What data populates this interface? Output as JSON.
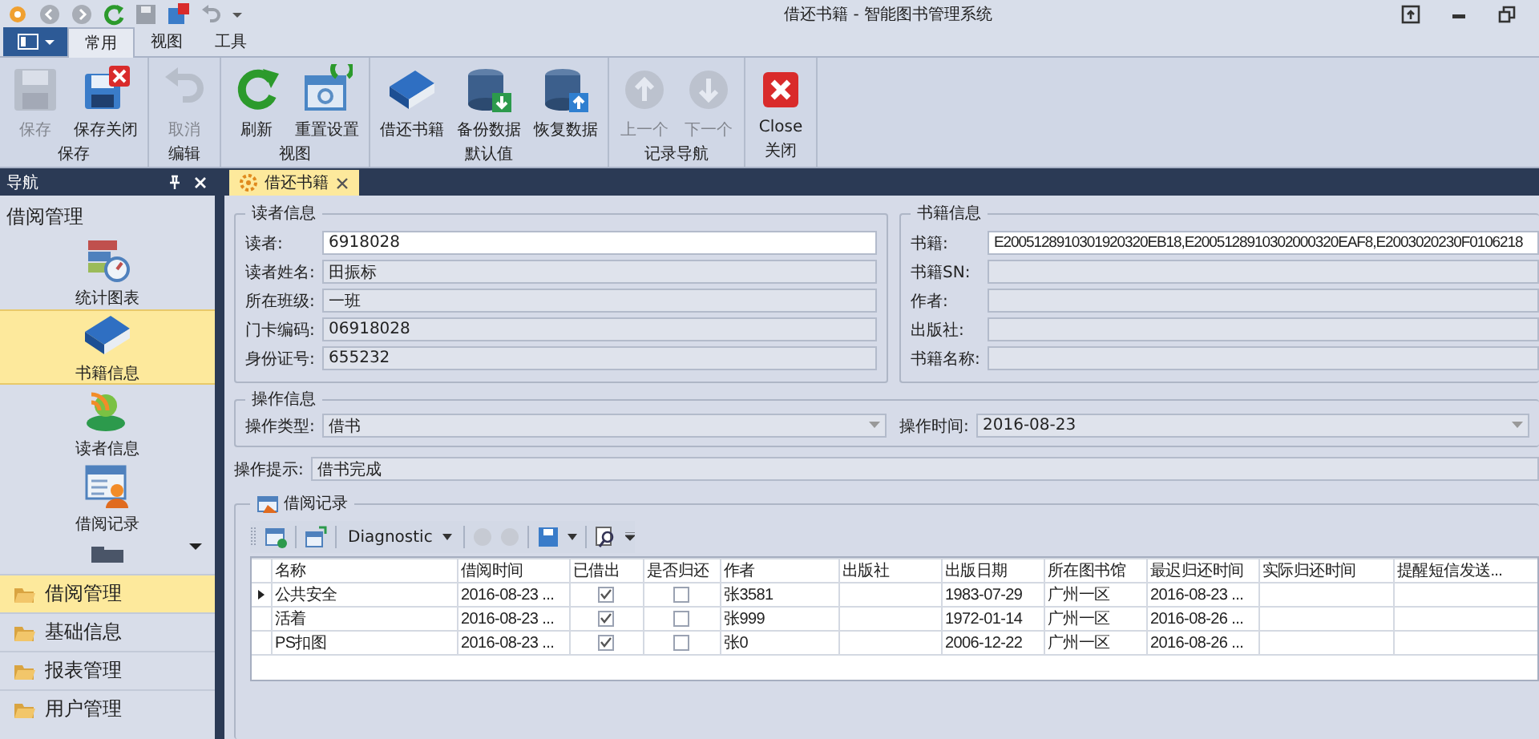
{
  "window": {
    "title": "借还书籍 - 智能图书管理系统"
  },
  "menu_tabs": [
    {
      "label": "常用",
      "selected": true
    },
    {
      "label": "视图",
      "selected": false
    },
    {
      "label": "工具",
      "selected": false
    }
  ],
  "ribbon": [
    {
      "label": "保存",
      "buttons": [
        {
          "label": "保存",
          "disabled": true
        },
        {
          "label": "保存关闭",
          "disabled": false
        }
      ]
    },
    {
      "label": "编辑",
      "buttons": [
        {
          "label": "取消",
          "disabled": true
        }
      ]
    },
    {
      "label": "视图",
      "buttons": [
        {
          "label": "刷新",
          "disabled": false
        },
        {
          "label": "重置设置",
          "disabled": false
        }
      ]
    },
    {
      "label": "默认值",
      "buttons": [
        {
          "label": "借还书籍",
          "disabled": false
        },
        {
          "label": "备份数据",
          "disabled": false
        },
        {
          "label": "恢复数据",
          "disabled": false
        }
      ]
    },
    {
      "label": "记录导航",
      "buttons": [
        {
          "label": "上一个",
          "disabled": true
        },
        {
          "label": "下一个",
          "disabled": true
        }
      ]
    },
    {
      "label": "关闭",
      "buttons": [
        {
          "label": "Close",
          "disabled": false
        }
      ]
    }
  ],
  "navigation": {
    "title": "导航",
    "section": "借阅管理",
    "items": [
      {
        "label": "统计图表",
        "selected": false
      },
      {
        "label": "书籍信息",
        "selected": true
      },
      {
        "label": "读者信息",
        "selected": false
      },
      {
        "label": "借阅记录",
        "selected": false
      }
    ],
    "groups": [
      {
        "label": "借阅管理",
        "selected": true
      },
      {
        "label": "基础信息",
        "selected": false
      },
      {
        "label": "报表管理",
        "selected": false
      },
      {
        "label": "用户管理",
        "selected": false
      }
    ]
  },
  "document_tab": {
    "label": "借还书籍"
  },
  "reader_info": {
    "title": "读者信息",
    "fields": [
      {
        "label": "读者:",
        "value": "6918028",
        "readonly": false
      },
      {
        "label": "读者姓名:",
        "value": "田振标",
        "readonly": true
      },
      {
        "label": "所在班级:",
        "value": "一班",
        "readonly": true
      },
      {
        "label": "门卡编码:",
        "value": "06918028",
        "readonly": true
      },
      {
        "label": "身份证号:",
        "value": "655232",
        "readonly": true
      }
    ]
  },
  "book_info": {
    "title": "书籍信息",
    "fields": [
      {
        "label": "书籍:",
        "value": "E2005128910301920320EB18,E2005128910302000320EAF8,E2003020230F0106218",
        "readonly": false
      },
      {
        "label": "书籍SN:",
        "readonly": true
      },
      {
        "label": "作者:",
        "readonly": true
      },
      {
        "label": "出版社:",
        "readonly": true
      },
      {
        "label": "书籍名称:",
        "readonly": true
      }
    ]
  },
  "operation_info": {
    "title": "操作信息",
    "type_label": "操作类型:",
    "type_value": "借书",
    "time_label": "操作时间:",
    "time_value": "2016-08-23"
  },
  "hint": {
    "label": "操作提示:",
    "value": "借书完成"
  },
  "records": {
    "title": "借阅记录",
    "toolbar_dropdown": "Diagnostic",
    "columns": [
      {
        "label": "名称",
        "kind": "text"
      },
      {
        "label": "借阅时间",
        "kind": "text"
      },
      {
        "label": "已借出",
        "kind": "check"
      },
      {
        "label": "是否归还",
        "kind": "check"
      },
      {
        "label": "作者",
        "kind": "text"
      },
      {
        "label": "出版社",
        "kind": "text"
      },
      {
        "label": "出版日期",
        "kind": "text"
      },
      {
        "label": "所在图书馆",
        "kind": "text"
      },
      {
        "label": "最迟归还时间",
        "kind": "text"
      },
      {
        "label": "实际归还时间",
        "kind": "text"
      },
      {
        "label": "提醒短信发送...",
        "kind": "text"
      }
    ],
    "rows": [
      {
        "selected": true,
        "cells": [
          "公共安全",
          "2016-08-23 ...",
          true,
          false,
          "张3581",
          null,
          "1983-07-29",
          "广州一区",
          "2016-08-23 ...",
          null,
          null
        ]
      },
      {
        "selected": false,
        "cells": [
          "活着",
          "2016-08-23 ...",
          true,
          false,
          "张999",
          null,
          "1972-01-14",
          "广州一区",
          "2016-08-26 ...",
          null,
          null
        ]
      },
      {
        "selected": false,
        "cells": [
          "PS扣图",
          "2016-08-23 ...",
          true,
          false,
          "张0",
          null,
          "2006-12-22",
          "广州一区",
          "2016-08-26 ...",
          null,
          null
        ]
      }
    ]
  }
}
